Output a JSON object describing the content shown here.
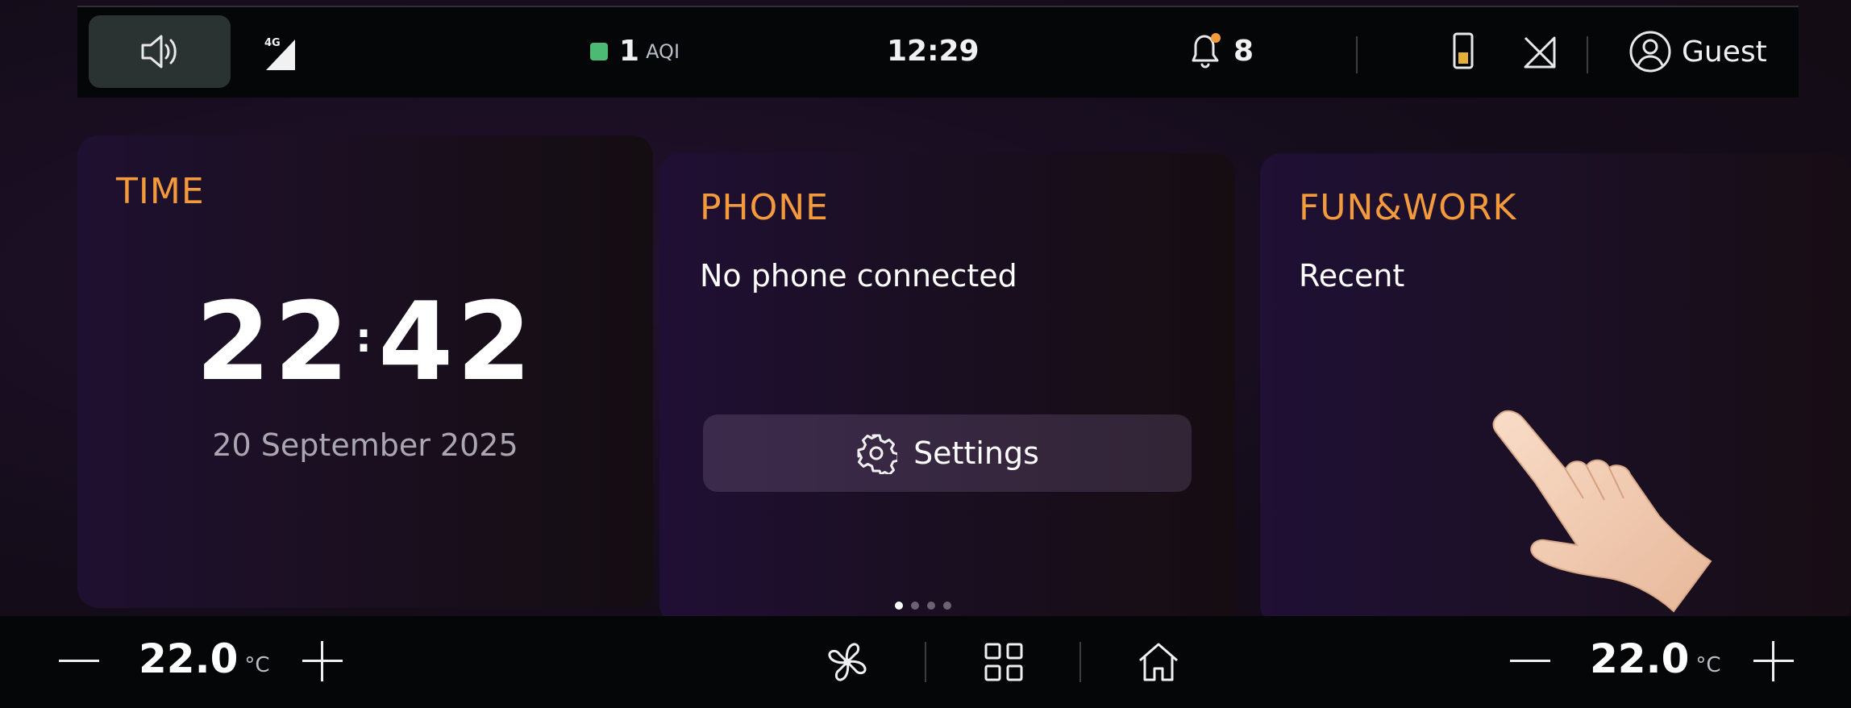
{
  "status_bar": {
    "network": "4G",
    "aqi_value": "1",
    "aqi_label": "AQI",
    "aqi_color": "#4cba74",
    "clock": "12:29",
    "notification_count": "8",
    "profile_name": "Guest"
  },
  "cards": {
    "time": {
      "title": "TIME",
      "hours": "22",
      "minutes": "42",
      "date": "20 September 2025"
    },
    "phone": {
      "title": "PHONE",
      "status": "No phone connected",
      "settings_label": "Settings",
      "page_count": 4,
      "active_page": 1
    },
    "fun_work": {
      "title": "FUN&WORK",
      "subtitle": "Recent"
    }
  },
  "climate": {
    "left_temp": "22.0",
    "right_temp": "22.0",
    "unit": "°C"
  },
  "colors": {
    "accent_orange": "#f39a3d",
    "bar_background": "#050608",
    "volume_button": "#2b3332"
  }
}
